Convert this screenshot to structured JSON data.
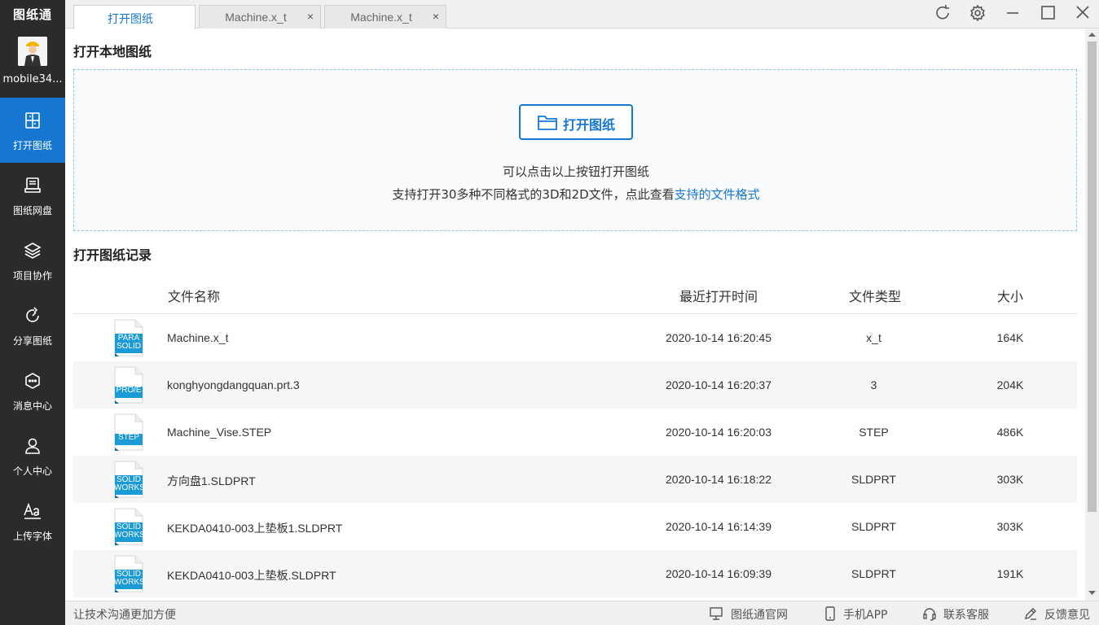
{
  "app": {
    "logo_text": "图纸通",
    "username": "mobile34..."
  },
  "sidebar": {
    "items": [
      {
        "label": "打开图纸",
        "icon": "open-drawing-icon"
      },
      {
        "label": "图纸网盘",
        "icon": "cloud-disk-icon"
      },
      {
        "label": "项目协作",
        "icon": "layers-icon"
      },
      {
        "label": "分享图纸",
        "icon": "share-icon"
      },
      {
        "label": "消息中心",
        "icon": "message-icon"
      },
      {
        "label": "个人中心",
        "icon": "user-icon"
      },
      {
        "label": "上传字体",
        "icon": "font-icon"
      }
    ]
  },
  "tabs": [
    {
      "label": "打开图纸",
      "active": true
    },
    {
      "label": "Machine.x_t",
      "close": "×"
    },
    {
      "label": "Machine.x_t",
      "close": "×"
    }
  ],
  "main": {
    "open_local_title": "打开本地图纸",
    "open_button": "打开图纸",
    "hint1": "可以点击以上按钮打开图纸",
    "hint2_prefix": "支持打开30多种不同格式的3D和2D文件，点此查看",
    "hint2_link": "支持的文件格式",
    "history_title": "打开图纸记录"
  },
  "table": {
    "headers": {
      "name": "文件名称",
      "time": "最近打开时间",
      "type": "文件类型",
      "size": "大小"
    },
    "rows": [
      {
        "icon_top": "PARA",
        "icon_bottom": "SOLID",
        "name": "Machine.x_t",
        "time": "2020-10-14 16:20:45",
        "type": "x_t",
        "size": "164K"
      },
      {
        "icon_top": "PRO/E",
        "icon_bottom": "",
        "name": "konghyongdangquan.prt.3",
        "time": "2020-10-14 16:20:37",
        "type": "3",
        "size": "204K"
      },
      {
        "icon_top": "STEP",
        "icon_bottom": "",
        "name": "Machine_Vise.STEP",
        "time": "2020-10-14 16:20:03",
        "type": "STEP",
        "size": "486K"
      },
      {
        "icon_top": "SOLID",
        "icon_bottom": "WORKS",
        "name": "方向盘1.SLDPRT",
        "time": "2020-10-14 16:18:22",
        "type": "SLDPRT",
        "size": "303K"
      },
      {
        "icon_top": "SOLID",
        "icon_bottom": "WORKS",
        "name": "KEKDA0410-003上垫板1.SLDPRT",
        "time": "2020-10-14 16:14:39",
        "type": "SLDPRT",
        "size": "303K"
      },
      {
        "icon_top": "SOLID",
        "icon_bottom": "WORKS",
        "name": "KEKDA0410-003上垫板.SLDPRT",
        "time": "2020-10-14 16:09:39",
        "type": "SLDPRT",
        "size": "191K"
      }
    ]
  },
  "footer": {
    "slogan": "让技术沟通更加方便",
    "official_site": "图纸通官网",
    "mobile_app": "手机APP",
    "support": "联系客服",
    "feedback": "反馈意见"
  },
  "colors": {
    "accent": "#1677d2",
    "sidebar": "#2b2b2b",
    "file_icon": "#1a9ad6"
  }
}
